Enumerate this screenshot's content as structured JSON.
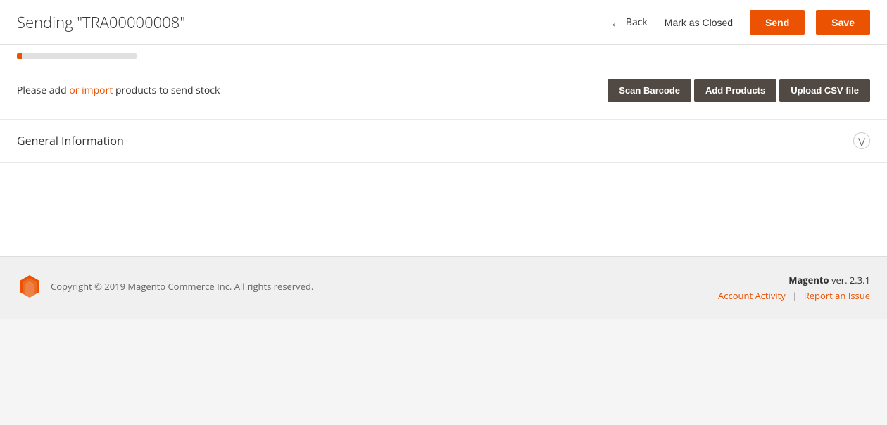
{
  "header": {
    "title": "Sending \"TRA00000008\"",
    "back_label": "Back",
    "mark_closed_label": "Mark as Closed",
    "send_label": "Send",
    "save_label": "Save"
  },
  "products_section": {
    "message_prefix": "Please add ",
    "message_link": "or import",
    "message_suffix": " products to send stock",
    "scan_barcode_label": "Scan Barcode",
    "add_products_label": "Add Products",
    "upload_csv_label": "Upload CSV file"
  },
  "general_info": {
    "title": "General Information"
  },
  "footer": {
    "copyright": "Copyright © 2019 Magento Commerce Inc. All rights reserved.",
    "version_brand": "Magento",
    "version_number": "ver. 2.3.1",
    "account_activity_label": "Account Activity",
    "separator": "|",
    "report_issue_label": "Report an Issue"
  },
  "progress": {
    "fill_percent": 4
  }
}
